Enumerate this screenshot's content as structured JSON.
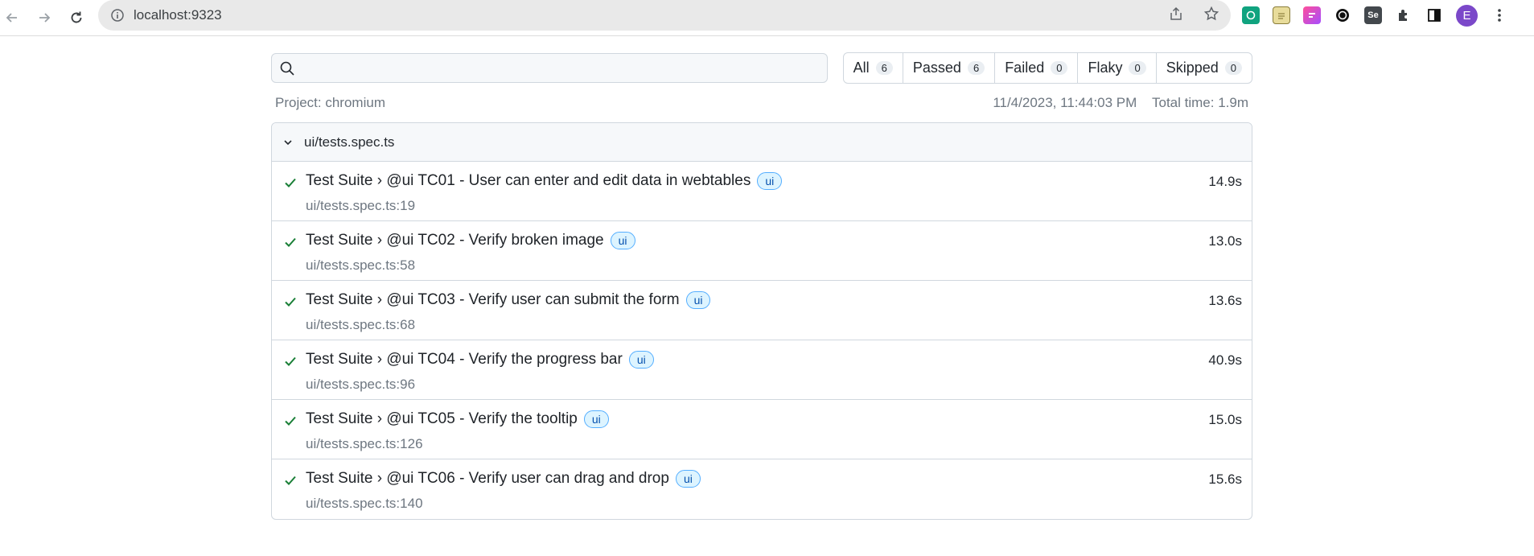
{
  "browser": {
    "url": "localhost:9323",
    "avatar_letter": "E",
    "extension_icons": [
      "chatgpt-icon",
      "notes-icon",
      "flag-icon",
      "openai-icon",
      "selenium-icon",
      "puzzle-icon",
      "sidepanel-icon"
    ]
  },
  "search": {
    "placeholder": "",
    "value": ""
  },
  "filters": [
    {
      "label": "All",
      "count": "6"
    },
    {
      "label": "Passed",
      "count": "6"
    },
    {
      "label": "Failed",
      "count": "0"
    },
    {
      "label": "Flaky",
      "count": "0"
    },
    {
      "label": "Skipped",
      "count": "0"
    }
  ],
  "meta": {
    "project": "Project: chromium",
    "timestamp": "11/4/2023, 11:44:03 PM",
    "total_time": "Total time: 1.9m"
  },
  "file": {
    "name": "ui/tests.spec.ts",
    "tests": [
      {
        "title": "Test Suite › @ui TC01 - User can enter and edit data in webtables",
        "tag": "ui",
        "location": "ui/tests.spec.ts:19",
        "duration": "14.9s"
      },
      {
        "title": "Test Suite › @ui TC02 - Verify broken image",
        "tag": "ui",
        "location": "ui/tests.spec.ts:58",
        "duration": "13.0s"
      },
      {
        "title": "Test Suite › @ui TC03 - Verify user can submit the form",
        "tag": "ui",
        "location": "ui/tests.spec.ts:68",
        "duration": "13.6s"
      },
      {
        "title": "Test Suite › @ui TC04 - Verify the progress bar",
        "tag": "ui",
        "location": "ui/tests.spec.ts:96",
        "duration": "40.9s"
      },
      {
        "title": "Test Suite › @ui TC05 - Verify the tooltip",
        "tag": "ui",
        "location": "ui/tests.spec.ts:126",
        "duration": "15.0s"
      },
      {
        "title": "Test Suite › @ui TC06 - Verify user can drag and drop",
        "tag": "ui",
        "location": "ui/tests.spec.ts:140",
        "duration": "15.6s"
      }
    ]
  },
  "colors": {
    "pass": "#1a7f37",
    "tag_bg": "#ddf4ff",
    "tag_border": "#54aeff",
    "avatar": "#7b48c9"
  }
}
